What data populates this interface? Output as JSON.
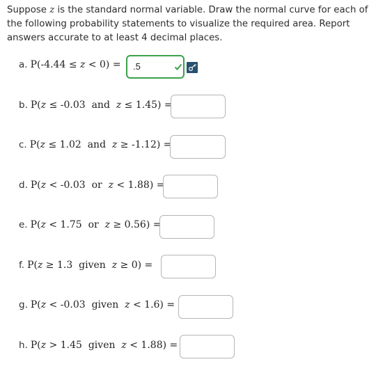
{
  "intro": {
    "line1a": "Suppose ",
    "z": "z",
    "line1b": " is the standard normal variable. Draw the normal curve for each of the following probability statements to visualize the required area. Report answers accurate to at least 4 decimal places."
  },
  "questions": [
    {
      "letter": "a.",
      "expr": "P(-4.44 ≤ z < 0) =",
      "answer": ".5"
    },
    {
      "letter": "b.",
      "expr": "P(z ≤ -0.03  and  z ≤ 1.45) =",
      "answer": ""
    },
    {
      "letter": "c.",
      "expr": "P(z ≤ 1.02  and  z ≥ -1.12) =",
      "answer": ""
    },
    {
      "letter": "d.",
      "expr": "P(z < -0.03  or  z < 1.88) =",
      "answer": ""
    },
    {
      "letter": "e.",
      "expr": "P(z < 1.75  or  z ≥ 0.56) =",
      "answer": ""
    },
    {
      "letter": "f.",
      "expr": "P(z ≥ 1.3  given  z ≥ 0) =",
      "answer": ""
    },
    {
      "letter": "g.",
      "expr": "P(z < -0.03  given  z < 1.6) =",
      "answer": ""
    },
    {
      "letter": "h.",
      "expr": "P(z > 1.45  given  z < 1.88) =",
      "answer": ""
    }
  ],
  "colors": {
    "correct": "#3aa14a",
    "key_button": "#28506f"
  },
  "icons": {
    "check": "check-icon",
    "key": "key-icon"
  }
}
